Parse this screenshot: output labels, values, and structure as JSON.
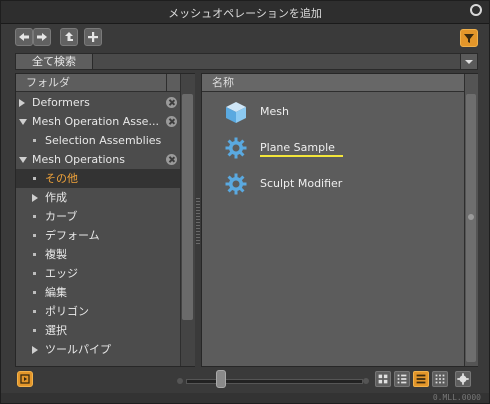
{
  "window": {
    "title": "メッシュオペレーションを追加"
  },
  "toolbar": {
    "back_icon": "arrow-left-icon",
    "forward_icon": "arrow-right-icon",
    "up_icon": "up-level-icon",
    "add_icon": "plus-icon",
    "filter_icon": "filter-icon"
  },
  "search": {
    "scope_label": "全て検索",
    "value": ""
  },
  "folders": {
    "header": "フォルダ",
    "items": [
      {
        "label": "Deformers",
        "level": 0,
        "expander": "collapsed",
        "removable": true,
        "selected": false
      },
      {
        "label": "Mesh Operation Asse...",
        "level": 0,
        "expander": "expanded",
        "removable": true,
        "selected": false
      },
      {
        "label": "Selection Assemblies",
        "level": 1,
        "expander": "leaf",
        "removable": false,
        "selected": false
      },
      {
        "label": "Mesh Operations",
        "level": 0,
        "expander": "expanded",
        "removable": true,
        "selected": false
      },
      {
        "label": "その他",
        "level": 1,
        "expander": "leaf",
        "removable": false,
        "selected": true
      },
      {
        "label": "作成",
        "level": 1,
        "expander": "collapsed",
        "removable": false,
        "selected": false
      },
      {
        "label": "カーブ",
        "level": 1,
        "expander": "leaf",
        "removable": false,
        "selected": false
      },
      {
        "label": "デフォーム",
        "level": 1,
        "expander": "leaf",
        "removable": false,
        "selected": false
      },
      {
        "label": "複製",
        "level": 1,
        "expander": "leaf",
        "removable": false,
        "selected": false
      },
      {
        "label": "エッジ",
        "level": 1,
        "expander": "leaf",
        "removable": false,
        "selected": false
      },
      {
        "label": "編集",
        "level": 1,
        "expander": "leaf",
        "removable": false,
        "selected": false
      },
      {
        "label": "ポリゴン",
        "level": 1,
        "expander": "leaf",
        "removable": false,
        "selected": false
      },
      {
        "label": "選択",
        "level": 1,
        "expander": "leaf",
        "removable": false,
        "selected": false
      },
      {
        "label": "ツールパイプ",
        "level": 1,
        "expander": "collapsed",
        "removable": false,
        "selected": false
      }
    ]
  },
  "items": {
    "header": "名称",
    "list": [
      {
        "label": "Mesh",
        "icon": "cube-icon",
        "highlighted": false
      },
      {
        "label": "Plane Sample",
        "icon": "gear-icon",
        "highlighted": true
      },
      {
        "label": "Sculpt Modifier",
        "icon": "gear-icon",
        "highlighted": false
      }
    ]
  },
  "bottom": {
    "panel_toggle_icon": "panel-toggle-icon",
    "thumbnail_size": 0.2,
    "view_modes": [
      {
        "icon": "large-grid-icon",
        "active": false
      },
      {
        "icon": "small-grid-icon",
        "active": false
      },
      {
        "icon": "list-view-icon",
        "active": true
      },
      {
        "icon": "tiny-grid-icon",
        "active": false
      },
      {
        "icon": "settings-gear-icon",
        "active": false
      }
    ],
    "status_text": "0.MLL.0000"
  },
  "colors": {
    "accent": "#e3962a",
    "highlight": "#f3e63a",
    "selected_text": "#f0a33a"
  }
}
